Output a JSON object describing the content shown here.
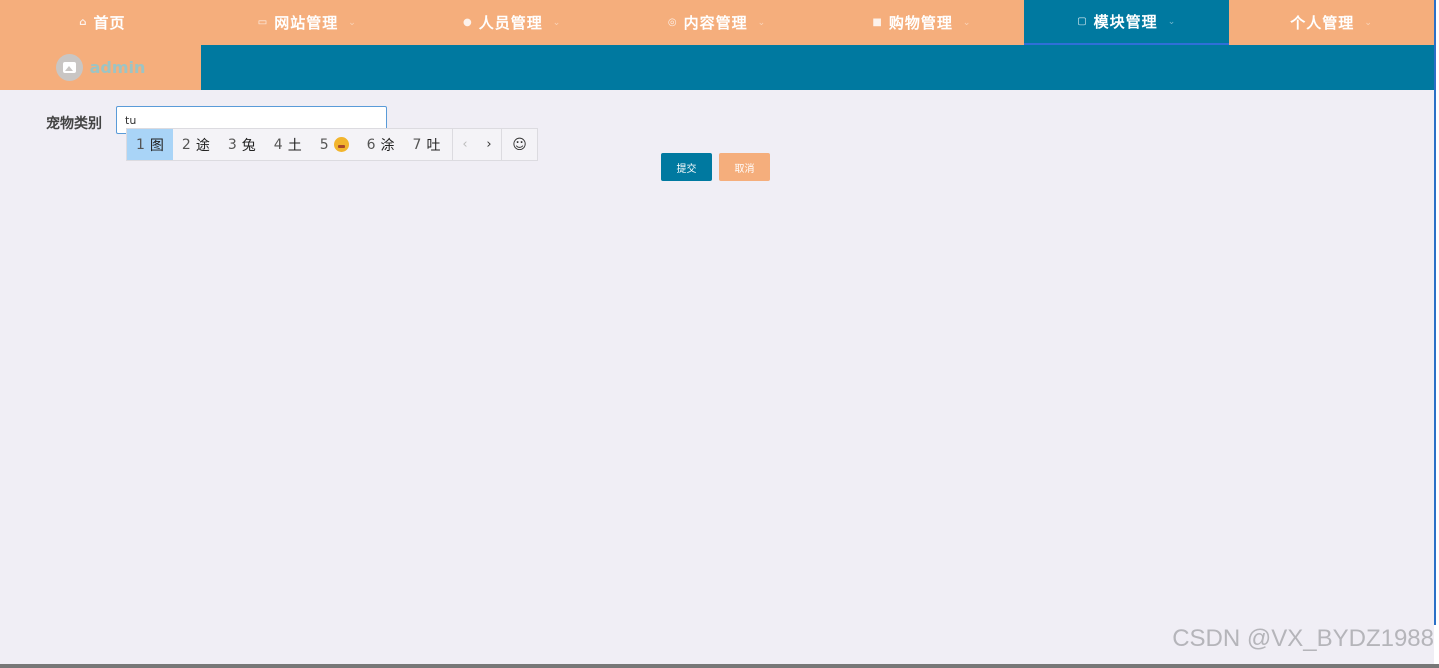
{
  "nav": {
    "items": [
      {
        "label": "首页",
        "icon": "home-icon",
        "glyph": "⌂",
        "dropdown": false
      },
      {
        "label": "网站管理",
        "icon": "monitor-icon",
        "glyph": "▭",
        "dropdown": true
      },
      {
        "label": "人员管理",
        "icon": "user-icon",
        "glyph": "●",
        "dropdown": true
      },
      {
        "label": "内容管理",
        "icon": "content-icon",
        "glyph": "◎",
        "dropdown": true
      },
      {
        "label": "购物管理",
        "icon": "bag-icon",
        "glyph": "■",
        "dropdown": true
      },
      {
        "label": "模块管理",
        "icon": "module-icon",
        "glyph": "▢",
        "dropdown": true
      },
      {
        "label": "个人管理",
        "icon": "",
        "glyph": "",
        "dropdown": true
      }
    ],
    "active_index": 5,
    "chevron": "⌄"
  },
  "user": {
    "name": "admin"
  },
  "form": {
    "label": "宠物类别",
    "input_value": "tu",
    "submit_label": "提交",
    "cancel_label": "取消"
  },
  "ime": {
    "candidates": [
      {
        "num": "1",
        "text": "图"
      },
      {
        "num": "2",
        "text": "途"
      },
      {
        "num": "3",
        "text": "兔"
      },
      {
        "num": "4",
        "text": "土"
      },
      {
        "num": "5",
        "text": "",
        "emoji": "grimace-emoji"
      },
      {
        "num": "6",
        "text": "涂"
      },
      {
        "num": "7",
        "text": "吐"
      }
    ],
    "selected_index": 0,
    "prev": "‹",
    "next": "›",
    "emoji_button": "☺"
  },
  "watermark": "CSDN @VX_BYDZ1988",
  "colors": {
    "accent": "#0079a0",
    "nav": "#f5ae7c",
    "background": "#f0eef5"
  }
}
